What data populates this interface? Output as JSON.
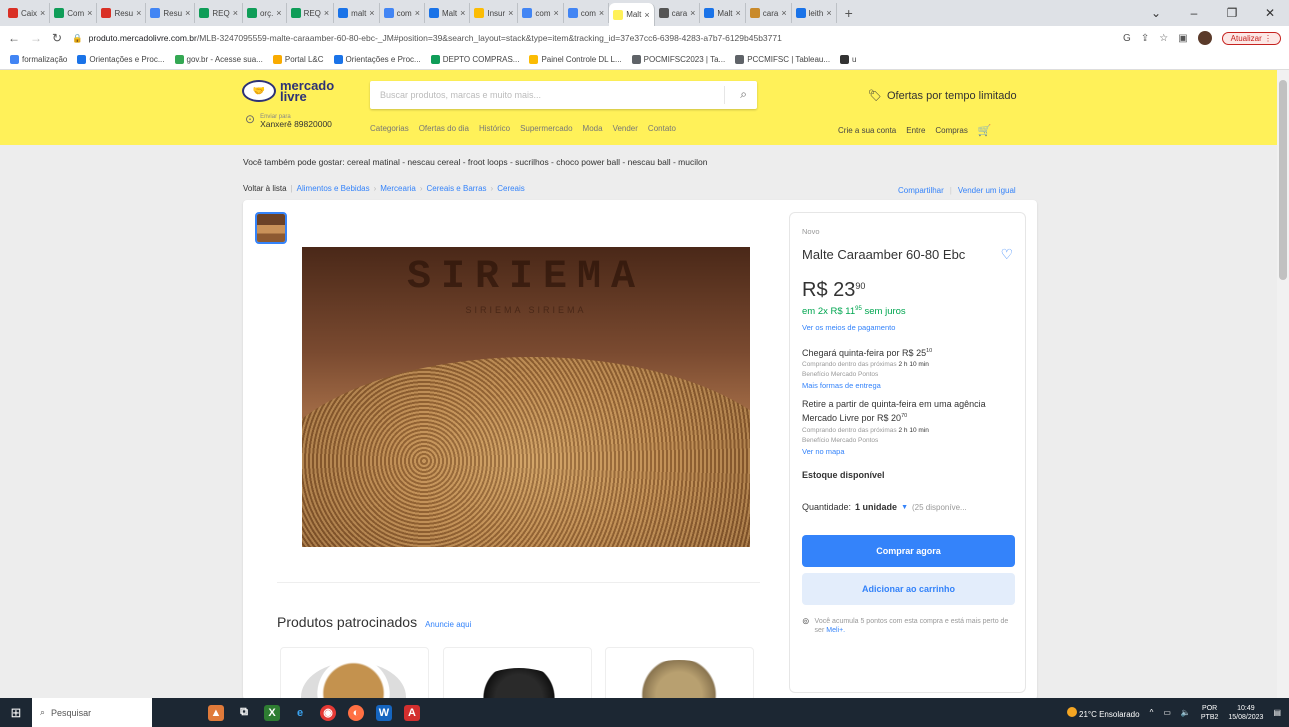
{
  "browser": {
    "tabs": [
      {
        "label": "Caix",
        "color": "#d93025"
      },
      {
        "label": "Com",
        "color": "#0f9d58"
      },
      {
        "label": "Resu",
        "color": "#d93025"
      },
      {
        "label": "Resu",
        "color": "#4285f4"
      },
      {
        "label": "REQ",
        "color": "#0f9d58"
      },
      {
        "label": "orç.",
        "color": "#0f9d58"
      },
      {
        "label": "REQ",
        "color": "#0f9d58"
      },
      {
        "label": "malt",
        "color": "#1a73e8"
      },
      {
        "label": "com",
        "color": "#4285f4"
      },
      {
        "label": "Malt",
        "color": "#1a73e8"
      },
      {
        "label": "Insur",
        "color": "#fbbc04"
      },
      {
        "label": "com",
        "color": "#4285f4"
      },
      {
        "label": "com",
        "color": "#4285f4"
      },
      {
        "label": "Malt",
        "color": "#fff159",
        "active": true
      },
      {
        "label": "cara",
        "color": "#555"
      },
      {
        "label": "Malt",
        "color": "#1a73e8"
      },
      {
        "label": "cara",
        "color": "#c98a2b"
      },
      {
        "label": "leith",
        "color": "#1a73e8"
      }
    ],
    "new_tab": "+",
    "url_domain": "produto.mercadolivre.com.br",
    "url_path": "/MLB-3247095559-malte-caraamber-60-80-ebc-_JM#position=39&search_layout=stack&type=item&tracking_id=37e37cc6-6398-4283-a7b7-6129b45b3771",
    "update_label": "Atualizar",
    "bookmarks": [
      "formalização",
      "Orientações e Proc...",
      "gov.br - Acesse sua...",
      "Portal L&C",
      "Orientações e Proc...",
      "DEPTO COMPRAS...",
      "Painel Controle DL L...",
      "POCMIFSC2023 | Ta...",
      "PCCMIFSC | Tableau...",
      "u"
    ]
  },
  "header": {
    "logo_line1": "mercado",
    "logo_line2": "livre",
    "search_placeholder": "Buscar produtos, marcas e muito mais...",
    "offers": "Ofertas por tempo limitado",
    "ship_small": "Enviar para",
    "ship_location": "Xanxerê 89820000",
    "nav": [
      "Categorias",
      "Ofertas do dia",
      "Histórico",
      "Supermercado",
      "Moda",
      "Vender",
      "Contato"
    ],
    "user_nav": [
      "Crie a sua conta",
      "Entre",
      "Compras"
    ]
  },
  "suggestions": {
    "prefix": "Você também pode gostar:",
    "items": "cereal matinal - nescau cereal - froot loops - sucrilhos - choco power ball - nescau ball - mucilon"
  },
  "breadcrumb": {
    "back": "Voltar à lista",
    "items": [
      "Alimentos e Bebidas",
      "Mercearia",
      "Cereais e Barras",
      "Cereais"
    ]
  },
  "share": {
    "share": "Compartilhar",
    "sell": "Vender um igual"
  },
  "product": {
    "image_brand": "SIRIEMA",
    "image_sub": "SIRIEMA  SIRIEMA",
    "condition": "Novo",
    "title": "Malte Caraamber 60-80 Ebc",
    "price_int": "R$ 23",
    "price_cents": "90",
    "installments_pre": "em",
    "installments_val": "2x R$ 11",
    "installments_cents": "95",
    "installments_post": "sem juros",
    "payment_link": "Ver os meios de pagamento",
    "delivery": "Chegará quinta-feira por R$ 25",
    "delivery_cents": "10",
    "delivery_note": "Comprando dentro das próximas",
    "delivery_time": "2 h 10 min",
    "benefit": "Benefício Mercado Pontos",
    "more_delivery": "Mais formas de entrega",
    "pickup": "Retire a partir de quinta-feira em uma agência Mercado Livre por R$ 20",
    "pickup_cents": "70",
    "pickup_note": "Comprando dentro das próximas",
    "pickup_time": "2 h 10 min",
    "pickup_benefit": "Benefício Mercado Pontos",
    "map_link": "Ver no mapa",
    "stock": "Estoque disponível",
    "qty_label": "Quantidade:",
    "qty_value": "1 unidade",
    "qty_avail": "(25 disponíve...",
    "buy_now": "Comprar agora",
    "add_cart": "Adicionar ao carrinho",
    "points": "Você acumula 5 pontos com esta compra e está mais perto de ser",
    "points_link": "Meli+."
  },
  "sponsored": {
    "title": "Produtos patrocinados",
    "link": "Anuncie aqui"
  },
  "taskbar": {
    "search": "Pesquisar",
    "weather": "21°C Ensolarado",
    "lang": "POR",
    "lang2": "PTB2",
    "time": "10:49",
    "date": "15/08/2023"
  }
}
